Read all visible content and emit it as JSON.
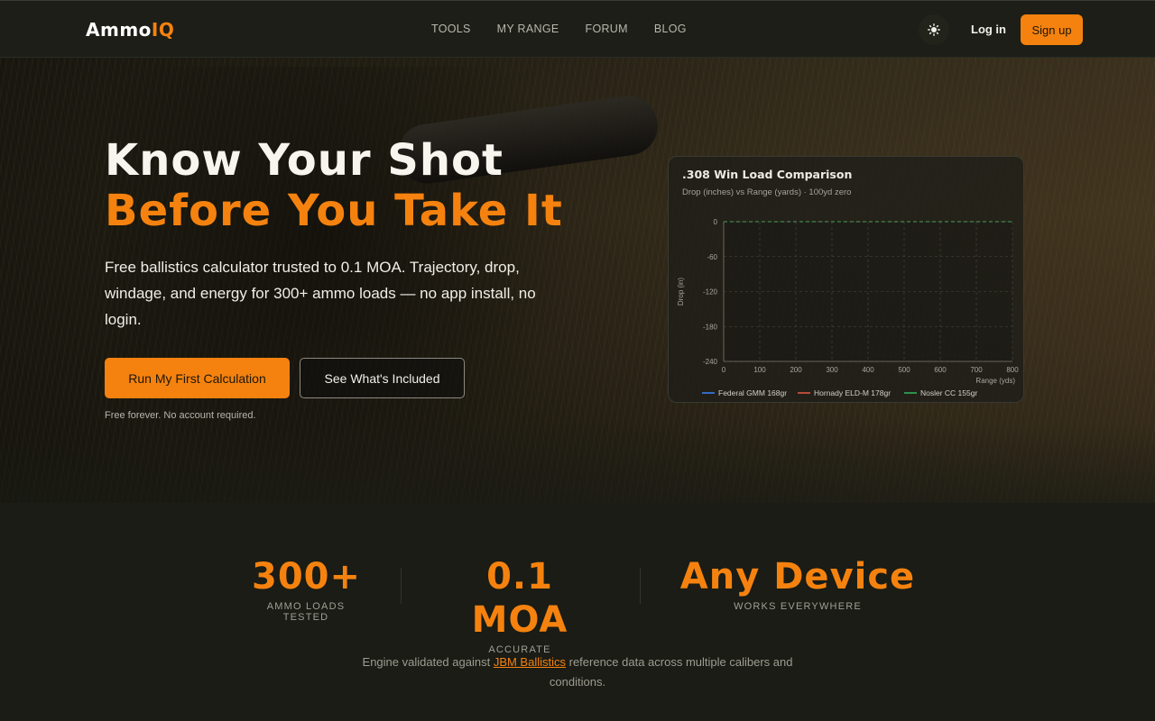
{
  "brand": {
    "name_prefix": "Ammo",
    "name_suffix": "IQ"
  },
  "nav": {
    "links": [
      "TOOLS",
      "MY RANGE",
      "FORUM",
      "BLOG"
    ],
    "login": "Log in",
    "signup": "Sign up"
  },
  "hero": {
    "title_line1": "Know Your Shot",
    "title_line2": "Before You Take It",
    "subtitle": "Free ballistics calculator trusted to 0.1 MOA. Trajectory, drop, windage, and energy for 300+ ammo loads — no app install, no login.",
    "primary_button": "Run My First Calculation",
    "secondary_button": "See What's Included",
    "note": "Free forever. No account required."
  },
  "chart_card": {
    "title": ".308 Win Load Comparison",
    "subtitle": "Drop (inches) vs Range (yards) · 100yd zero"
  },
  "chart_data": {
    "type": "line",
    "title": ".308 Win Load Comparison",
    "subtitle": "Drop (inches) vs Range (yards) · 100yd zero",
    "xlabel": "Range (yds)",
    "ylabel": "Drop (in)",
    "x": [
      0,
      100,
      200,
      300,
      400,
      500,
      600,
      700,
      800
    ],
    "xlim": [
      0,
      800
    ],
    "ylim": [
      -240,
      0
    ],
    "yticks": [
      0,
      -60,
      -120,
      -180,
      -240
    ],
    "grid": true,
    "legend": "bottom",
    "series": [
      {
        "name": "Federal GMM 168gr",
        "color": "#3b7cf0",
        "values": [
          0,
          0,
          0,
          0,
          0,
          0,
          0,
          0,
          0
        ]
      },
      {
        "name": "Hornady ELD-M 178gr",
        "color": "#e0543f",
        "values": [
          0,
          0,
          0,
          0,
          0,
          0,
          0,
          0,
          0
        ]
      },
      {
        "name": "Nosler CC 155gr",
        "color": "#2fae5c",
        "values": [
          0,
          0,
          0,
          0,
          0,
          0,
          0,
          0,
          0
        ]
      }
    ]
  },
  "stats": [
    {
      "value": "300+",
      "label": "AMMO LOADS TESTED"
    },
    {
      "value": "0.1 MOA",
      "label": "ACCURATE"
    },
    {
      "value": "Any Device",
      "label": "WORKS EVERYWHERE"
    }
  ],
  "validation": {
    "before": "Engine validated against ",
    "link": "JBM Ballistics",
    "after": " reference data across multiple calibers and conditions."
  },
  "colors": {
    "accent": "#f5820f",
    "background": "#1a1c15"
  },
  "icons": {
    "theme_toggle": "sun-icon"
  }
}
